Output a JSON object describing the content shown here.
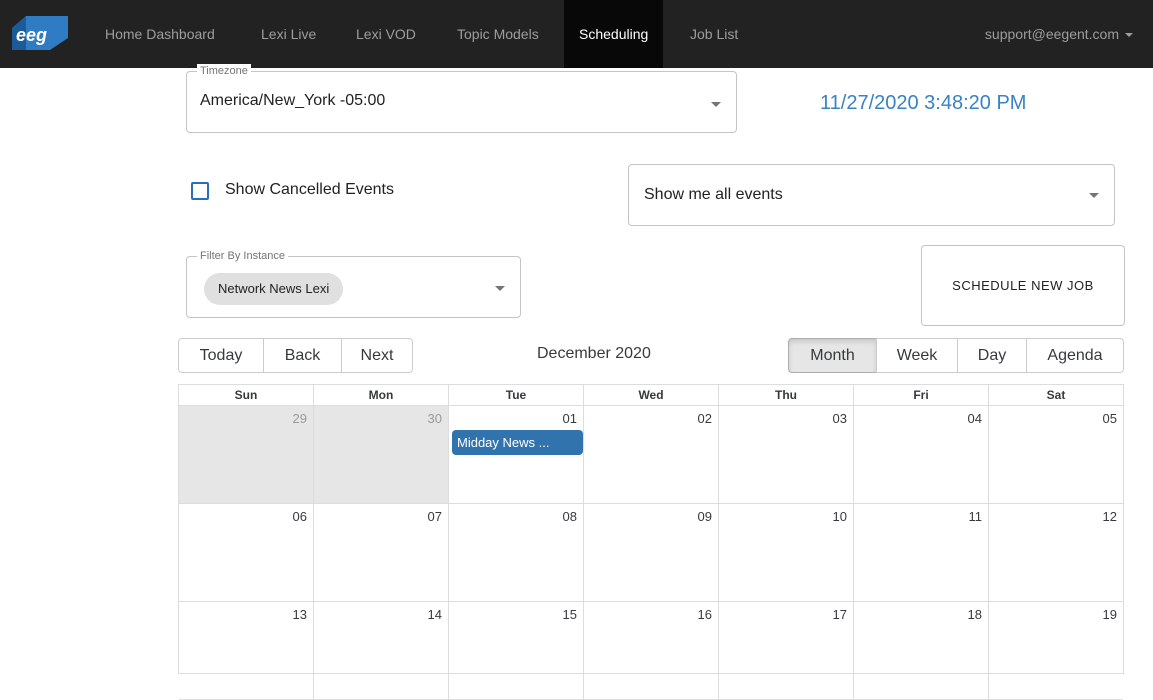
{
  "nav": {
    "logo_text": "eeg",
    "items": [
      "Home Dashboard",
      "Lexi Live",
      "Lexi VOD",
      "Topic Models",
      "Scheduling",
      "Job List"
    ],
    "active_item": "Scheduling",
    "user_email": "support@eegent.com"
  },
  "timezone": {
    "legend": "Timezone",
    "value": "America/New_York -05:00"
  },
  "clock": "11/27/2020 3:48:20 PM",
  "cancelled": {
    "label": "Show Cancelled Events",
    "checked": false
  },
  "event_filter": {
    "value": "Show me all events"
  },
  "instance_filter": {
    "legend": "Filter By Instance",
    "chip": "Network News Lexi"
  },
  "schedule_button": "SCHEDULE NEW JOB",
  "toolbar": {
    "today": "Today",
    "back": "Back",
    "next": "Next",
    "label": "December 2020",
    "views": [
      "Month",
      "Week",
      "Day",
      "Agenda"
    ],
    "active_view": "Month"
  },
  "calendar": {
    "weekdays": [
      "Sun",
      "Mon",
      "Tue",
      "Wed",
      "Thu",
      "Fri",
      "Sat"
    ],
    "weeks": [
      [
        "29",
        "30",
        "01",
        "02",
        "03",
        "04",
        "05"
      ],
      [
        "06",
        "07",
        "08",
        "09",
        "10",
        "11",
        "12"
      ],
      [
        "13",
        "14",
        "15",
        "16",
        "17",
        "18",
        "19"
      ]
    ],
    "off_range_days": [
      "29",
      "30"
    ],
    "event": {
      "title": "Midday News ...",
      "day": "01",
      "color": "#3174ad"
    }
  }
}
